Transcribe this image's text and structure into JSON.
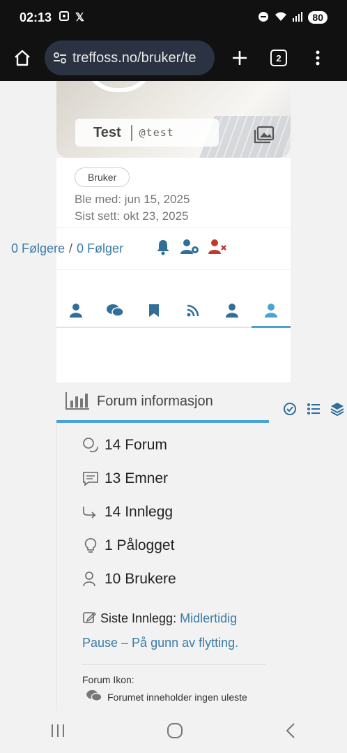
{
  "statusbar": {
    "time": "02:13",
    "battery": "80"
  },
  "browser": {
    "url": "treffoss.no/bruker/te",
    "tab_count": "2"
  },
  "profile": {
    "display_name": "Test",
    "handle": "@test",
    "role_badge": "Bruker",
    "joined": "Ble med: jun 15, 2025",
    "last_seen": "Sist sett: okt 23, 2025",
    "followers": "0 Følgere",
    "following": "0 Følger",
    "follow_separator": "/"
  },
  "forum_info": {
    "title": "Forum informasjon",
    "stats": [
      {
        "icon": "chat-bubbles-icon",
        "label": "14 Forum"
      },
      {
        "icon": "topics-icon",
        "label": "13 Emner"
      },
      {
        "icon": "reply-arrow-icon",
        "label": "14 Innlegg"
      },
      {
        "icon": "lightbulb-icon",
        "label": "1 Pålogget"
      },
      {
        "icon": "user-icon",
        "label": "10 Brukere"
      }
    ],
    "latest_label": "Siste Innlegg:",
    "latest_link": "Midlertidig Pause – På gunn av flytting.",
    "icons_title": "Forum Ikon:",
    "icon_desc": "Forumet inneholder ingen uleste"
  },
  "colors": {
    "accent": "#4aa3d4",
    "link": "#3a7ba8",
    "danger": "#c0392b"
  }
}
